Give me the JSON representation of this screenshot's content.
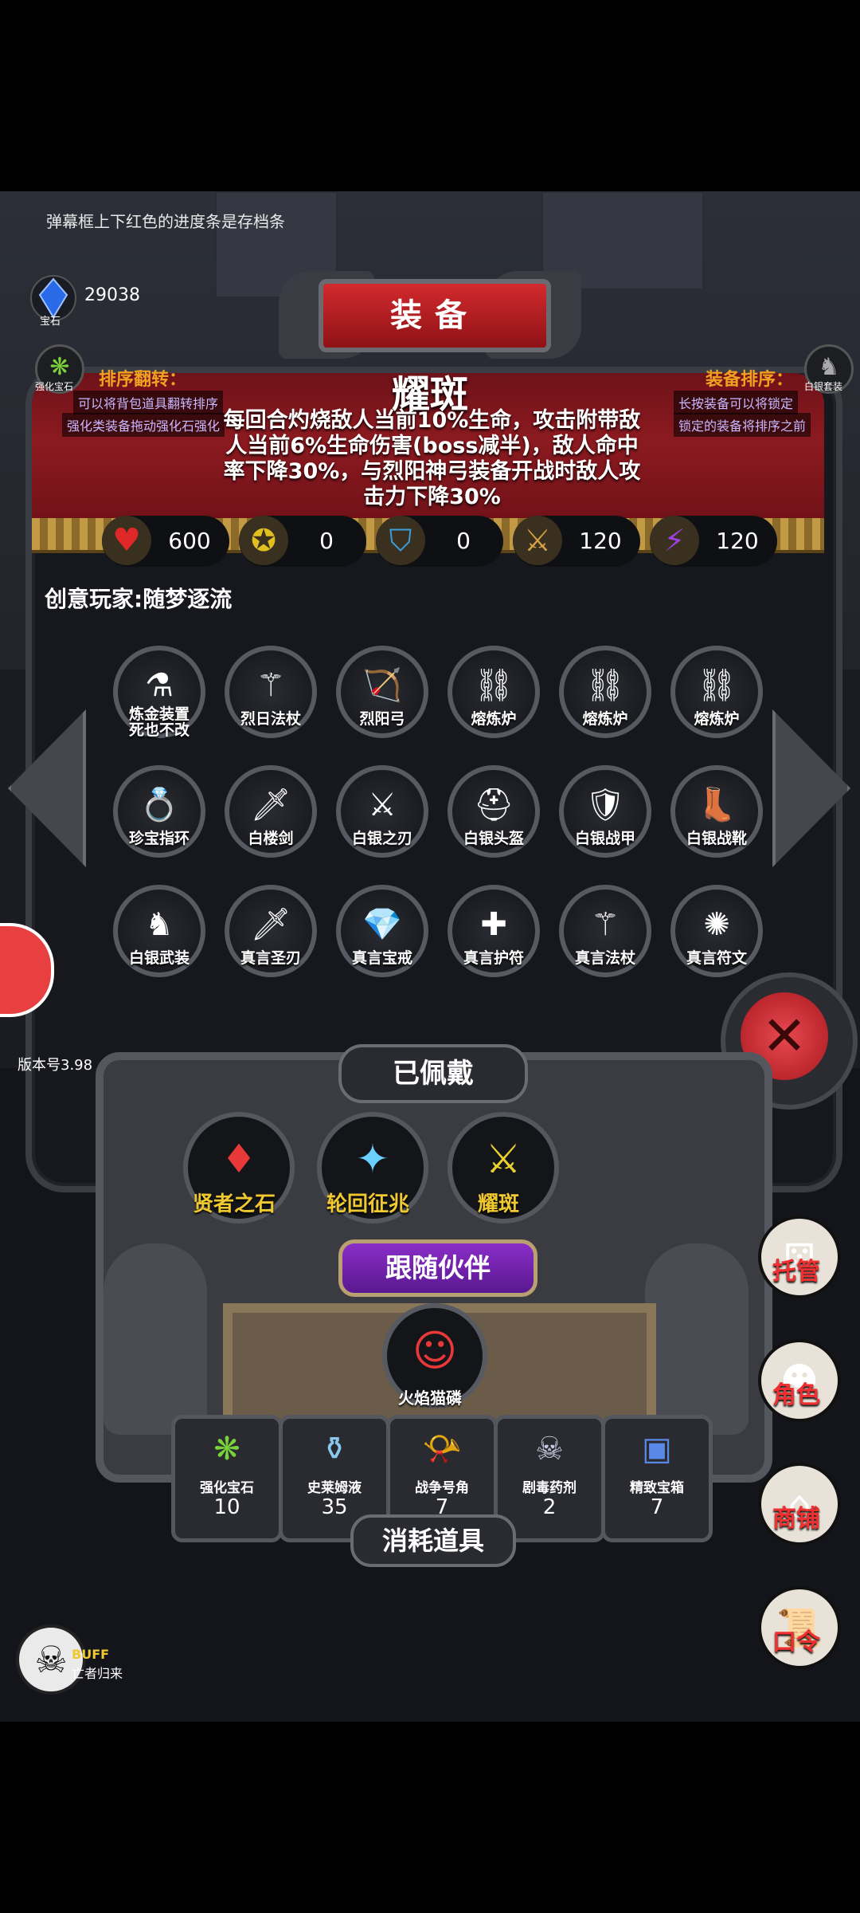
{
  "hint_text": "弹幕框上下红色的进度条是存档条",
  "gem": {
    "count": "29038",
    "label": "宝石"
  },
  "title": "装备",
  "item": {
    "name": "耀斑",
    "description": "每回合灼烧敌人当前10%生命，攻击附带敌人当前6%生命伤害(boss减半)，敌人命中率下降30%，与烈阳神弓装备开战时敌人攻击力下降30%"
  },
  "left_sort": {
    "icon_label": "强化宝石",
    "heading": "排序翻转：",
    "line1": "可以将背包道具翻转排序",
    "line2": "强化类装备拖动强化石强化"
  },
  "right_sort": {
    "icon_label": "白银套装",
    "heading": "装备排序：",
    "line1": "长按装备可以将锁定",
    "line2": "锁定的装备将排序之前"
  },
  "stats": [
    {
      "icon": "heart-icon",
      "value": "600",
      "color": "#e02828"
    },
    {
      "icon": "strength-icon",
      "value": "0",
      "color": "#e0c020"
    },
    {
      "icon": "shield-icon",
      "value": "0",
      "color": "#3aa0e0"
    },
    {
      "icon": "sword-icon",
      "value": "120",
      "color": "#d8a040"
    },
    {
      "icon": "lightning-icon",
      "value": "120",
      "color": "#a040e0"
    }
  ],
  "player_name": "创意玩家:随梦逐流",
  "grid": [
    {
      "label": "炼金装置\n死也不改",
      "glyph": "⚗"
    },
    {
      "label": "烈日法杖",
      "glyph": "⚚"
    },
    {
      "label": "烈阳弓",
      "glyph": "🏹"
    },
    {
      "label": "熔炼炉",
      "glyph": "⛓"
    },
    {
      "label": "熔炼炉",
      "glyph": "⛓"
    },
    {
      "label": "熔炼炉",
      "glyph": "⛓"
    },
    {
      "label": "珍宝指环",
      "glyph": "💍"
    },
    {
      "label": "白楼剑",
      "glyph": "🗡"
    },
    {
      "label": "白银之刃",
      "glyph": "⚔"
    },
    {
      "label": "白银头盔",
      "glyph": "⛑"
    },
    {
      "label": "白银战甲",
      "glyph": "🛡"
    },
    {
      "label": "白银战靴",
      "glyph": "👢"
    },
    {
      "label": "白银武装",
      "glyph": "♞"
    },
    {
      "label": "真言圣刃",
      "glyph": "🗡"
    },
    {
      "label": "真言宝戒",
      "glyph": "💎"
    },
    {
      "label": "真言护符",
      "glyph": "✚"
    },
    {
      "label": "真言法杖",
      "glyph": "⚚"
    },
    {
      "label": "真言符文",
      "glyph": "✺"
    }
  ],
  "version": "版本号3.98",
  "equipped": {
    "title": "已佩戴",
    "slots": [
      {
        "label": "贤者之石",
        "glyph": "♦"
      },
      {
        "label": "轮回征兆",
        "glyph": "✦"
      },
      {
        "label": "耀斑",
        "glyph": "⚔"
      }
    ]
  },
  "companion": {
    "title": "跟随伙伴",
    "name": "火焰猫磷",
    "glyph": "☺"
  },
  "consumables": {
    "title": "消耗道具",
    "items": [
      {
        "label": "强化宝石",
        "count": "10",
        "glyph": "❋"
      },
      {
        "label": "史莱姆液",
        "count": "35",
        "glyph": "⚱"
      },
      {
        "label": "战争号角",
        "count": "7",
        "glyph": "📯"
      },
      {
        "label": "剧毒药剂",
        "count": "2",
        "glyph": "☠"
      },
      {
        "label": "精致宝箱",
        "count": "7",
        "glyph": "▣"
      }
    ]
  },
  "right_menu": [
    {
      "label": "托管",
      "icon": "dice-icon",
      "glyph": "⚄"
    },
    {
      "label": "角色",
      "icon": "hood-icon",
      "glyph": "☻"
    },
    {
      "label": "商铺",
      "icon": "shop-icon",
      "glyph": "⌂"
    },
    {
      "label": "口令",
      "icon": "scroll-icon",
      "glyph": "📜"
    }
  ],
  "buff": {
    "label": "BUFF",
    "sub": "亡者归来"
  }
}
